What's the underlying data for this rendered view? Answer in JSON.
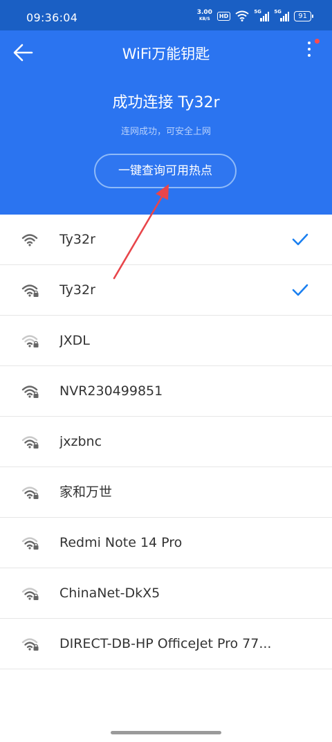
{
  "status": {
    "time": "09:36:04",
    "speed_value": "3.00",
    "speed_unit": "KB/S",
    "hd_label": "HD",
    "sim1_label": "5G",
    "sim2_label": "5G",
    "battery": "91"
  },
  "header": {
    "title": "WiFi万能钥匙",
    "connected_title": "成功连接 Ty32r",
    "connected_subtitle": "连网成功，可安全上网",
    "hotspot_button": "一键查询可用热点"
  },
  "networks": [
    {
      "ssid": "Ty32r",
      "locked": false,
      "checked": true,
      "signal": "strong"
    },
    {
      "ssid": "Ty32r",
      "locked": true,
      "checked": true,
      "signal": "strong"
    },
    {
      "ssid": "JXDL",
      "locked": true,
      "checked": false,
      "signal": "weak"
    },
    {
      "ssid": "NVR230499851",
      "locked": true,
      "checked": false,
      "signal": "strong"
    },
    {
      "ssid": "jxzbnc",
      "locked": true,
      "checked": false,
      "signal": "medium"
    },
    {
      "ssid": "家和万世",
      "locked": true,
      "checked": false,
      "signal": "medium"
    },
    {
      "ssid": "Redmi Note 14 Pro",
      "locked": true,
      "checked": false,
      "signal": "medium"
    },
    {
      "ssid": "ChinaNet-DkX5",
      "locked": true,
      "checked": false,
      "signal": "medium"
    },
    {
      "ssid": "DIRECT-DB-HP OfficeJet Pro 77...",
      "locked": true,
      "checked": false,
      "signal": "medium"
    }
  ],
  "colors": {
    "header_blue": "#2b74f0",
    "status_blue": "#1a5fc4",
    "check_blue": "#1a7ff0",
    "arrow_red": "#e8454a"
  }
}
